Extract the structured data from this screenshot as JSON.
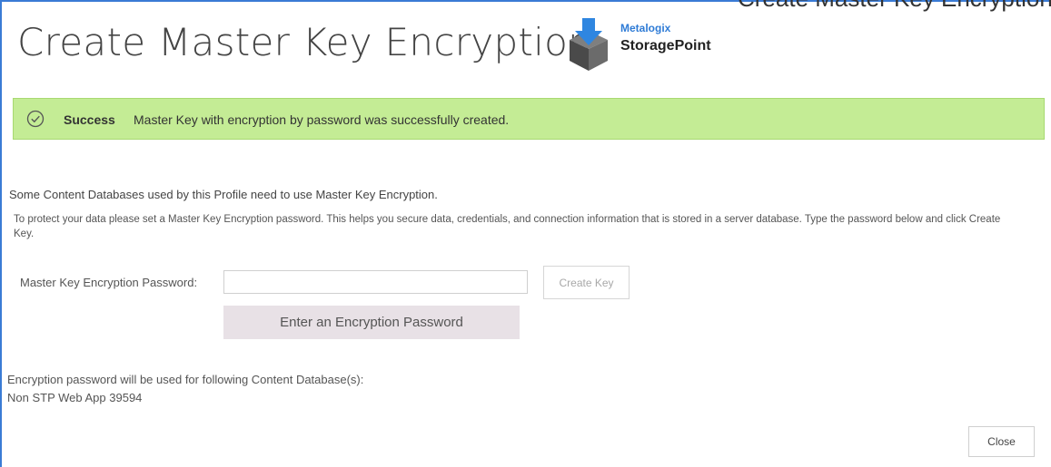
{
  "window": {
    "clipped_title": "Create Master Key Encryption",
    "title": "Create Master Key Encryption"
  },
  "logo": {
    "brand_top": "Metalogix",
    "brand_bottom": "StoragePoint",
    "icon": "package-download-icon"
  },
  "banner": {
    "icon": "check-circle-icon",
    "label": "Success",
    "message": "Master Key with encryption by password was successfully created."
  },
  "content": {
    "intro": "Some Content Databases used by this Profile need to use Master Key Encryption.",
    "description": "To protect your data please set a Master Key Encryption password. This helps you secure data, credentials, and connection information that is stored in a server database. Type the password below and click Create Key."
  },
  "form": {
    "password_label": "Master Key Encryption Password:",
    "password_value": "",
    "create_button": "Create Key",
    "hint": "Enter an Encryption Password"
  },
  "footer": {
    "databases_label": "Encryption password will be used for following Content Database(s):",
    "database_name": "Non STP Web App 39594",
    "close_button": "Close"
  },
  "colors": {
    "accent": "#3a7bd5",
    "success_bg": "#c4ec95",
    "hint_bg": "#e8e1e6"
  }
}
